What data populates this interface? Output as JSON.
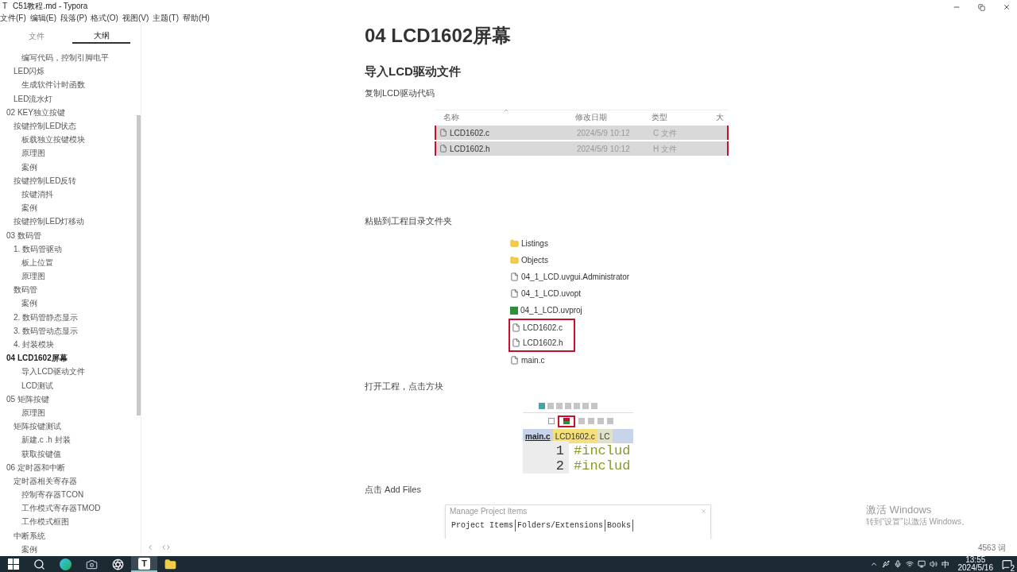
{
  "window": {
    "app_icon": "T",
    "title": "C51教程.md - Typora"
  },
  "menu": [
    "文件(F)",
    "编辑(E)",
    "段落(P)",
    "格式(O)",
    "视图(V)",
    "主题(T)",
    "帮助(H)"
  ],
  "sidebar": {
    "tabs": [
      {
        "label": "文件",
        "selected": false
      },
      {
        "label": "大纲",
        "selected": true
      }
    ],
    "outline": [
      {
        "children": [
          {
            "children": [
              {
                "label": "编写代码，控制引脚电平",
                "selected": false
              }
            ]
          },
          {
            "label": "LED闪烁",
            "selected": false,
            "children": [
              {
                "label": "生成软件计时函数",
                "selected": false
              }
            ]
          },
          {
            "label": "LED流水灯",
            "selected": false
          }
        ]
      },
      {
        "label": "02 KEY独立按键",
        "selected": false,
        "children": [
          {
            "label": "按键控制LED状态",
            "selected": false,
            "children": [
              {
                "label": "板载独立按键模块",
                "selected": false
              },
              {
                "label": "原理图",
                "selected": false
              },
              {
                "label": "案例",
                "selected": false
              }
            ]
          },
          {
            "label": "按键控制LED反转",
            "selected": false,
            "children": [
              {
                "label": "按键消抖",
                "selected": false
              },
              {
                "label": "案例",
                "selected": false
              }
            ]
          },
          {
            "label": "按键控制LED灯移动",
            "selected": false
          }
        ]
      },
      {
        "label": "03 数码管",
        "selected": false,
        "children": [
          {
            "label": "1. 数码管驱动",
            "selected": false,
            "children": [
              {
                "label": "板上位置",
                "selected": false
              },
              {
                "label": "原理图",
                "selected": false
              }
            ]
          },
          {
            "label": "数码管",
            "selected": false,
            "children": [
              {
                "label": "案例",
                "selected": false
              }
            ]
          },
          {
            "label": "2. 数码管静态显示",
            "selected": false
          },
          {
            "label": "3. 数码管动态显示",
            "selected": false
          },
          {
            "label": "4. 封装模块",
            "selected": false
          }
        ]
      },
      {
        "label": "04 LCD1602屏幕",
        "selected": true,
        "children": [
          {
            "children": [
              {
                "label": "导入LCD驱动文件",
                "selected": false
              },
              {
                "label": "LCD测试",
                "selected": false
              }
            ]
          }
        ]
      },
      {
        "label": "05 矩阵按键",
        "selected": false,
        "children": [
          {
            "children": [
              {
                "label": "原理图",
                "selected": false
              }
            ]
          },
          {
            "label": "矩阵按键测试",
            "selected": false,
            "children": [
              {
                "label": "新建.c .h 封装",
                "selected": false
              },
              {
                "label": "获取按键值",
                "selected": false
              }
            ]
          }
        ]
      },
      {
        "label": "06 定时器和中断",
        "selected": false,
        "children": [
          {
            "label": "定时器相关寄存器",
            "selected": false,
            "children": [
              {
                "label": "控制寄存器TCON",
                "selected": false
              },
              {
                "label": "工作模式寄存器TMOD",
                "selected": false
              },
              {
                "label": "工作模式框图",
                "selected": false
              }
            ]
          },
          {
            "label": "中断系统",
            "selected": false,
            "children": [
              {
                "label": "案例",
                "selected": false
              }
            ]
          }
        ]
      }
    ]
  },
  "document": {
    "blocks": [
      {
        "kind": "h1",
        "text": "04 LCD1602屏幕"
      },
      {
        "kind": "h2",
        "text": "导入LCD驱动文件"
      },
      {
        "kind": "p",
        "text": "复制LCD驱动代码"
      },
      {
        "kind": "explorer",
        "columns": [
          "名称",
          "修改日期",
          "类型",
          "大"
        ],
        "rows": [
          {
            "name": "LCD1602.c",
            "date": "2024/5/9 10:12",
            "type": "C 文件",
            "selected": true,
            "marked": true
          },
          {
            "name": "LCD1602.h",
            "date": "2024/5/9 10:12",
            "type": "H 文件",
            "selected": true,
            "marked": true
          }
        ]
      },
      {
        "kind": "p",
        "text": "粘贴到工程目录文件夹"
      },
      {
        "kind": "filelist",
        "items": [
          {
            "kind": "folder",
            "name": "Listings",
            "marked": false
          },
          {
            "kind": "folder",
            "name": "Objects",
            "marked": false
          },
          {
            "kind": "file",
            "name": "04_1_LCD.uvgui.Administrator",
            "marked": false
          },
          {
            "kind": "file",
            "name": "04_1_LCD.uvopt",
            "marked": false
          },
          {
            "kind": "project",
            "name": "04_1_LCD.uvproj",
            "marked": false
          },
          {
            "kind": "file",
            "name": "LCD1602.c",
            "marked": true
          },
          {
            "kind": "file",
            "name": "LCD1602.h",
            "marked": true
          },
          {
            "kind": "file",
            "name": "main.c",
            "marked": false
          }
        ]
      },
      {
        "kind": "p",
        "text": "打开工程，点击方块"
      },
      {
        "kind": "toolbar",
        "tabs": [
          {
            "label": "main.c",
            "selected": true
          },
          {
            "label": "LCD1602.c",
            "selected": false
          },
          {
            "label": "LC",
            "selected": false
          }
        ],
        "lines": [
          {
            "number": "1",
            "code": "#includ"
          },
          {
            "number": "2",
            "code": "#includ"
          }
        ]
      },
      {
        "kind": "p",
        "text": "点击 Add Files"
      },
      {
        "kind": "dialog",
        "title": "Manage Project Items",
        "tabs": [
          "Project Items",
          "Folders/Extensions",
          "Books"
        ]
      }
    ]
  },
  "footer": {
    "word_count": "4563 词"
  },
  "activation": {
    "title": "激活 Windows",
    "text": "转到“设置”以激活 Windows。"
  },
  "taskbar": {
    "apps": [
      {
        "kind": "start",
        "selected": false
      },
      {
        "kind": "search",
        "selected": false
      },
      {
        "kind": "edge",
        "selected": false
      },
      {
        "kind": "camera",
        "selected": false
      },
      {
        "kind": "obs",
        "selected": false
      },
      {
        "kind": "typora",
        "label": "T",
        "selected": true
      },
      {
        "kind": "explorer",
        "selected": false
      }
    ],
    "ime": "中",
    "time": "13:55",
    "date": "2024/5/16",
    "notifications": "2"
  }
}
